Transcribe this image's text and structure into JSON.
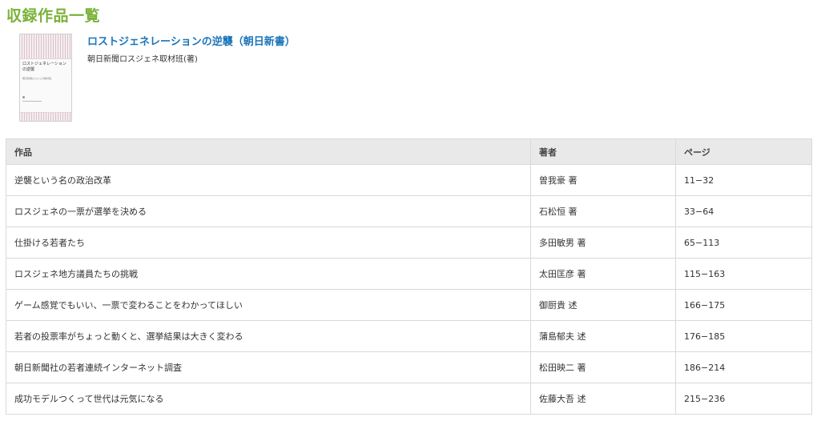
{
  "page": {
    "title": "収録作品一覧"
  },
  "book": {
    "title": "ロストジェネレーションの逆襲（朝日新書）",
    "author": "朝日新聞ロスジェネ取材班(著)",
    "cover_title": "ロストジェネレーションの逆襲",
    "cover_subtitle": "朝日新聞ロスジェネ取材班"
  },
  "table": {
    "headers": {
      "work": "作品",
      "author": "著者",
      "pages": "ページ"
    },
    "rows": [
      {
        "work": "逆襲という名の政治改革",
        "author": "曽我豪 著",
        "pages": "11−32"
      },
      {
        "work": "ロスジェネの一票が選挙を決める",
        "author": "石松恒 著",
        "pages": "33−64"
      },
      {
        "work": "仕掛ける若者たち",
        "author": "多田敏男 著",
        "pages": "65−113"
      },
      {
        "work": "ロスジェネ地方議員たちの挑戦",
        "author": "太田匡彦 著",
        "pages": "115−163"
      },
      {
        "work": "ゲーム感覚でもいい、一票で変わることをわかってほしい",
        "author": "御厨貴 述",
        "pages": "166−175"
      },
      {
        "work": "若者の投票率がちょっと動くと、選挙結果は大きく変わる",
        "author": "蒲島郁夫 述",
        "pages": "176−185"
      },
      {
        "work": "朝日新聞社の若者連続インターネット調査",
        "author": "松田映二 著",
        "pages": "186−214"
      },
      {
        "work": "成功モデルつくって世代は元気になる",
        "author": "佐藤大吾 述",
        "pages": "215−236"
      }
    ]
  },
  "colors": {
    "title_green": "#7ab23a",
    "link_blue": "#1c75b9",
    "header_bg": "#e9e9e9",
    "border": "#d9d9d9"
  }
}
